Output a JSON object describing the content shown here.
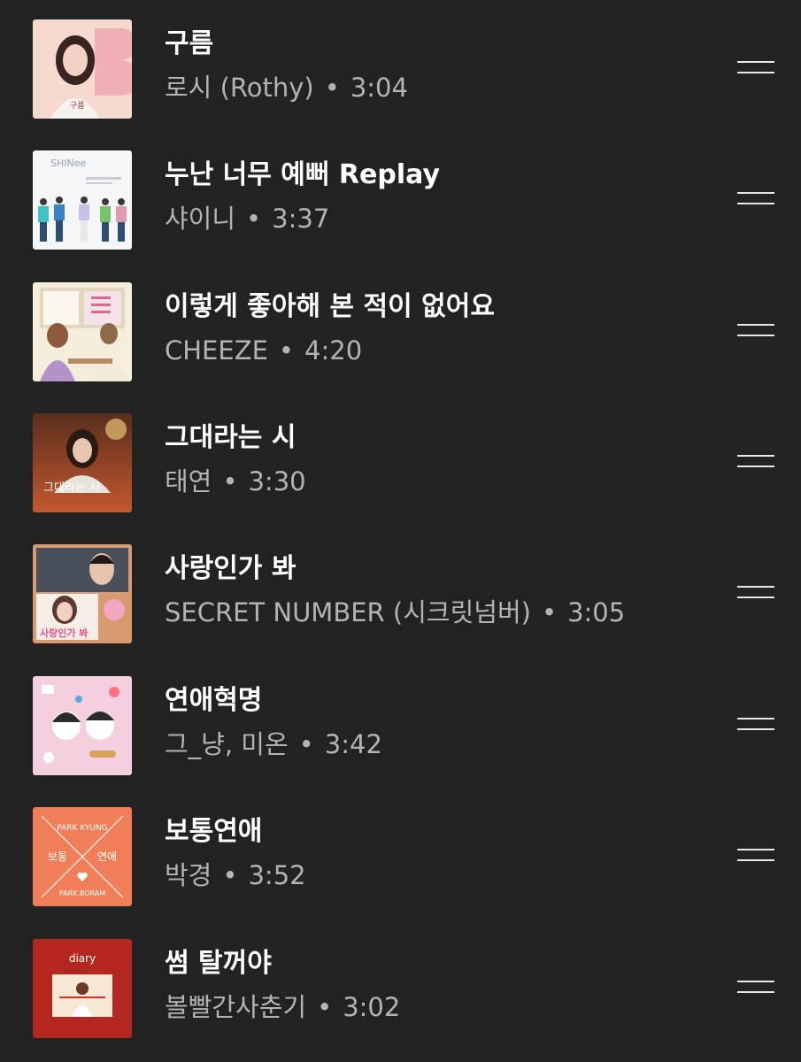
{
  "tracks": [
    {
      "title": "구름",
      "artist": "로시 (Rothy)",
      "separator": "•",
      "duration": "3:04",
      "art_icon": "album-art-pink-portrait",
      "art_text": "구름"
    },
    {
      "title": "누난 너무 예뻐 Replay",
      "artist": "샤이니",
      "separator": "•",
      "duration": "3:37",
      "art_icon": "album-art-shinee-group",
      "art_text": "SHINee"
    },
    {
      "title": "이렇게 좋아해 본 적이 없어요",
      "artist": "CHEEZE",
      "separator": "•",
      "duration": "4:20",
      "art_icon": "album-art-illustrated-classroom",
      "art_text": ""
    },
    {
      "title": "그대라는 시",
      "artist": "태연",
      "separator": "•",
      "duration": "3:30",
      "art_icon": "album-art-ost-poster",
      "art_text": "그대라는 시"
    },
    {
      "title": "사랑인가 봐",
      "artist": "SECRET NUMBER (시크릿넘버)",
      "separator": "•",
      "duration": "3:05",
      "art_icon": "album-art-drama-collage",
      "art_text": "사랑인가 봐"
    },
    {
      "title": "연애혁명",
      "artist": "그_냥, 미온",
      "separator": "•",
      "duration": "3:42",
      "art_icon": "album-art-cartoon-doodles",
      "art_text": ""
    },
    {
      "title": "보통연애",
      "artist": "박경",
      "separator": "•",
      "duration": "3:52",
      "art_icon": "album-art-orange-x",
      "art_text_top": "PARK KYUNG",
      "art_text_left": "보통",
      "art_text_right": "연애",
      "art_text_bottom": "PARK BORAM"
    },
    {
      "title": "썸 탈꺼야",
      "artist": "볼빨간사춘기",
      "separator": "•",
      "duration": "3:02",
      "art_icon": "album-art-red-diary",
      "art_text": "diary"
    }
  ],
  "colors": {
    "background": "#222222",
    "title": "#ffffff",
    "subtitle": "#b3b3b3",
    "handle": "#e8e8e8"
  }
}
